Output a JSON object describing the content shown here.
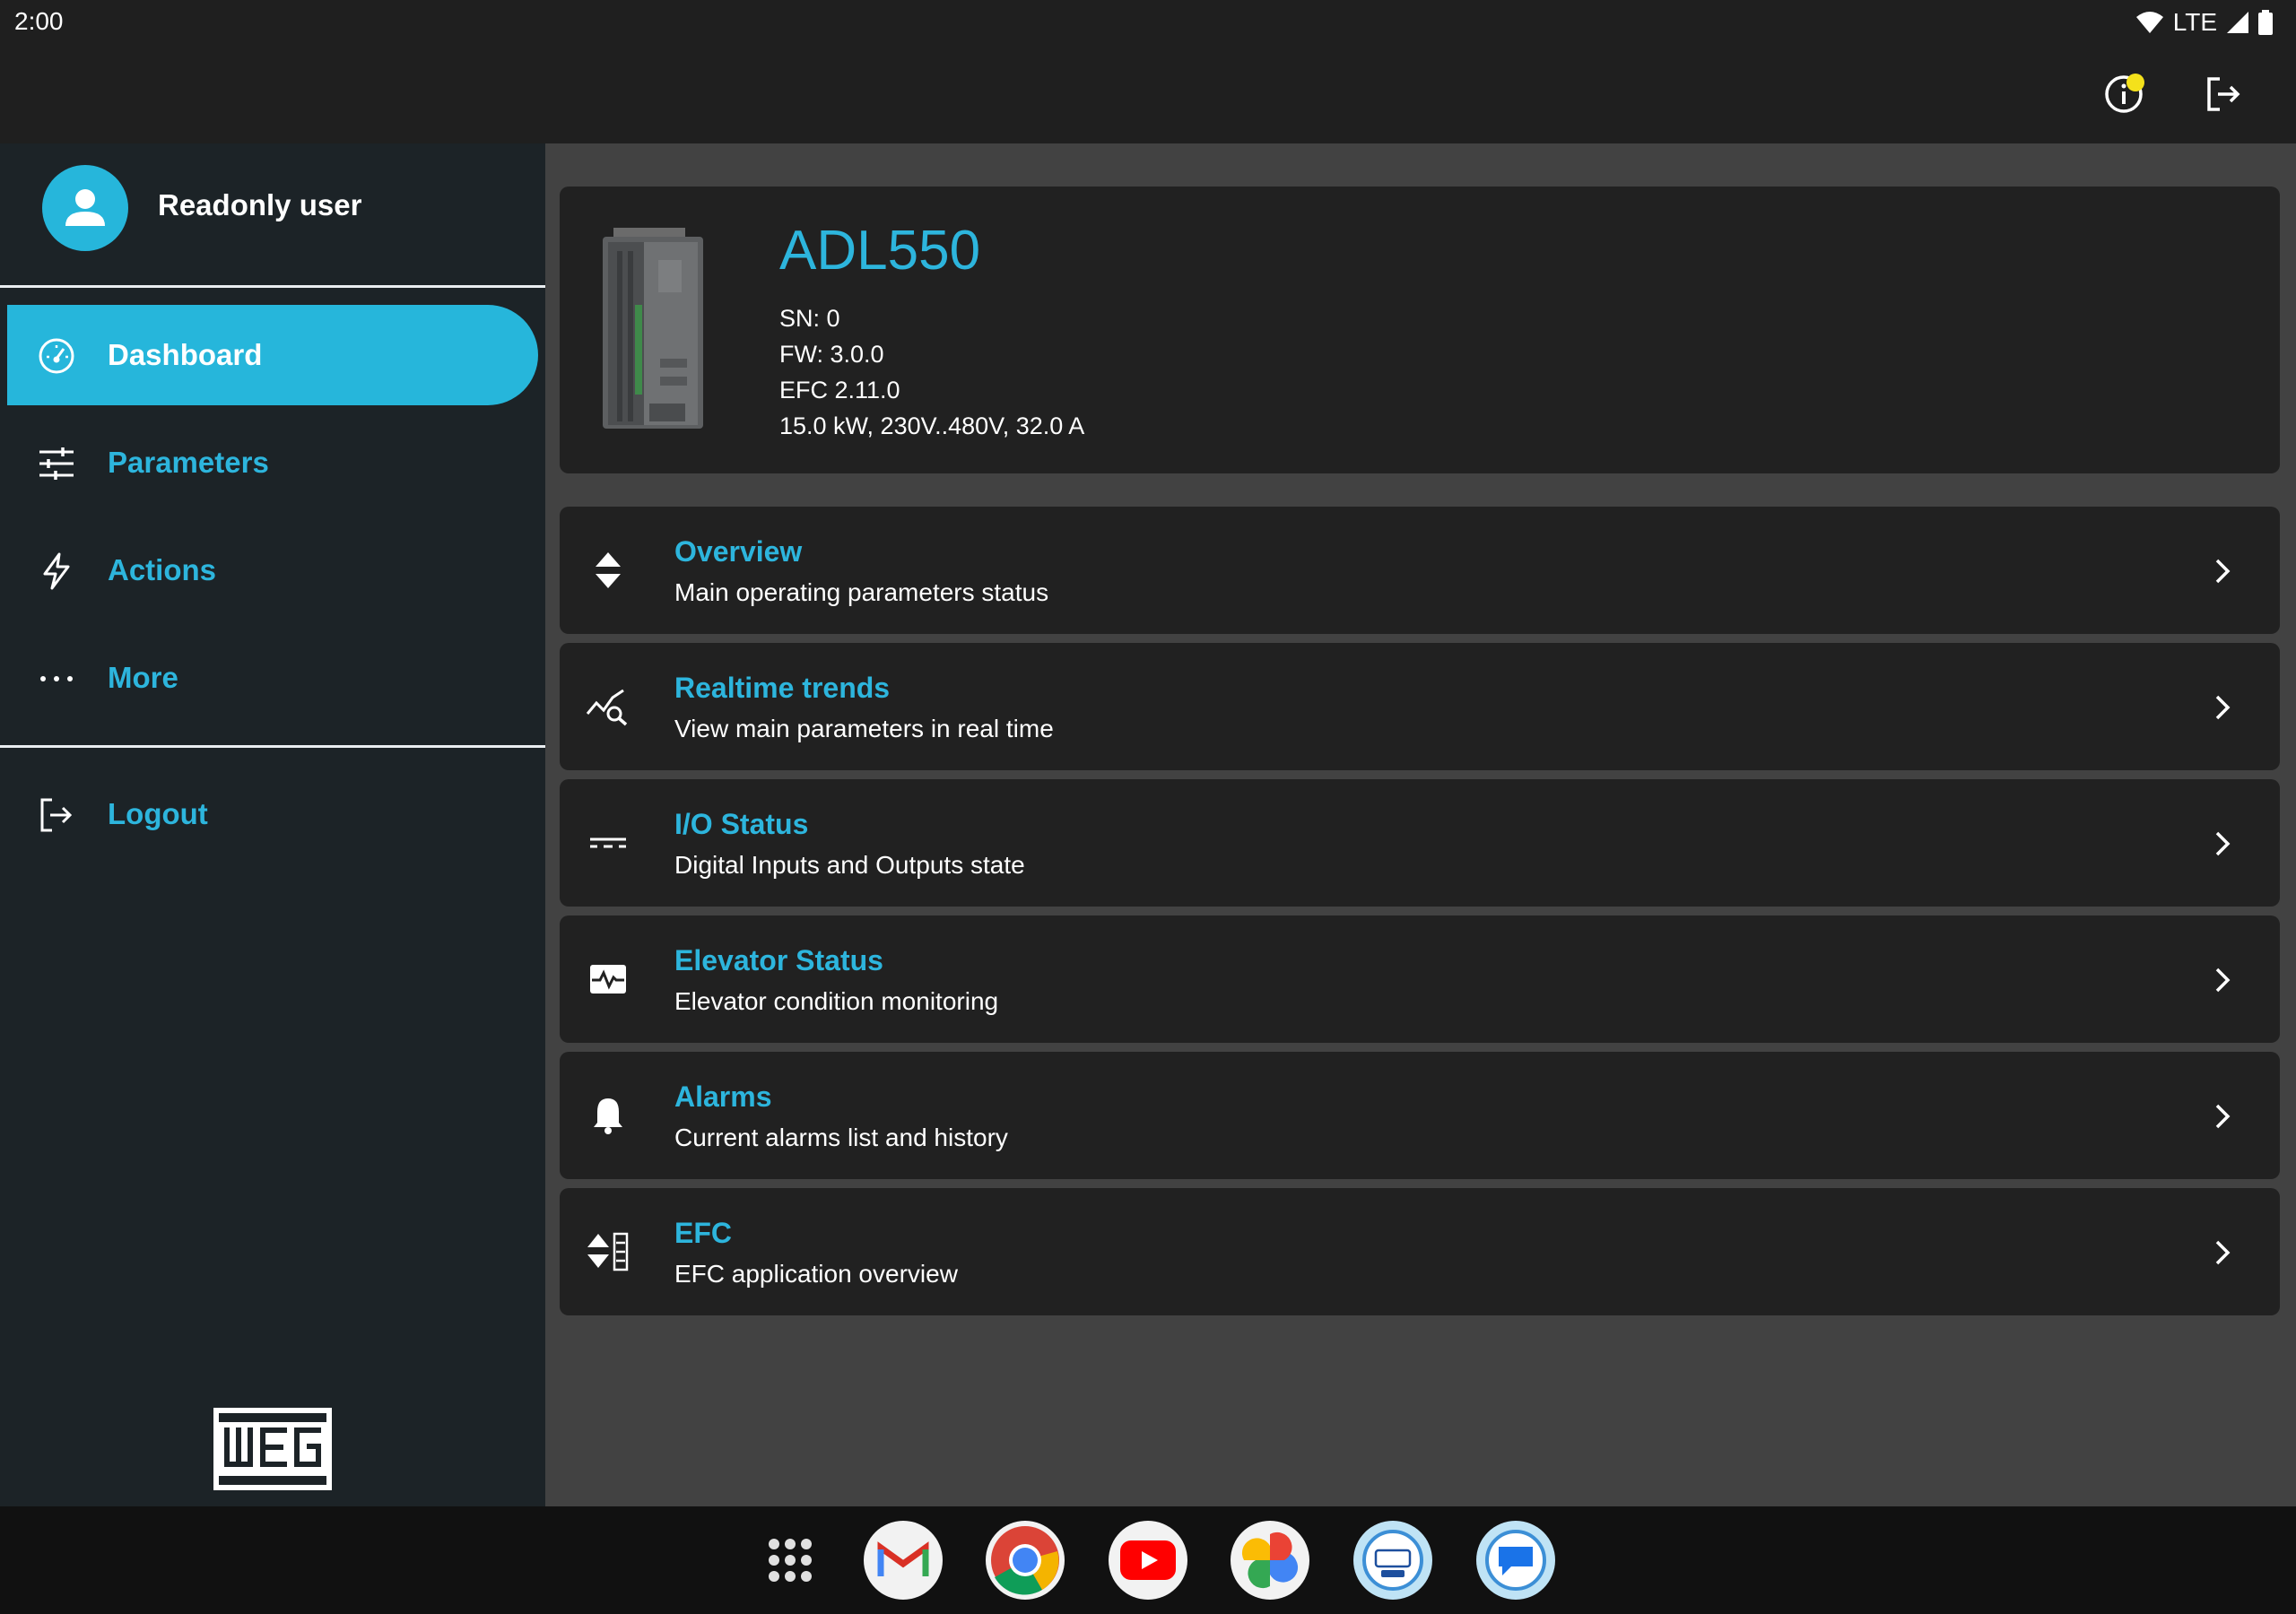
{
  "status_bar": {
    "time": "2:00",
    "network": "LTE",
    "icons": [
      "wifi-icon",
      "cell-signal-icon",
      "battery-icon"
    ]
  },
  "top_bar": {
    "actions": [
      "info-icon",
      "logout-icon"
    ],
    "notification_color": "#f4e11b"
  },
  "sidebar": {
    "user": {
      "name": "Readonly user",
      "avatar_icon": "person-icon"
    },
    "items": [
      {
        "label": "Dashboard",
        "icon": "dashboard-gauge-icon",
        "active": true
      },
      {
        "label": "Parameters",
        "icon": "tune-sliders-icon",
        "active": false
      },
      {
        "label": "Actions",
        "icon": "bolt-icon",
        "active": false
      },
      {
        "label": "More",
        "icon": "more-horizontal-icon",
        "active": false
      }
    ],
    "logout": {
      "label": "Logout",
      "icon": "logout-icon"
    },
    "brand_logo": "WEG"
  },
  "device": {
    "model": "ADL550",
    "sn": "SN: 0",
    "fw": "FW: 3.0.0",
    "efc": "EFC 2.11.0",
    "rating": "15.0 kW, 230V..480V, 32.0 A"
  },
  "menu": [
    {
      "title": "Overview",
      "subtitle": "Main operating parameters status",
      "icon": "up-down-arrows-icon"
    },
    {
      "title": "Realtime trends",
      "subtitle": "View main parameters in real time",
      "icon": "trend-search-icon"
    },
    {
      "title": "I/O Status",
      "subtitle": "Digital Inputs and Outputs state",
      "icon": "io-lines-icon"
    },
    {
      "title": "Elevator Status",
      "subtitle": "Elevator condition monitoring",
      "icon": "monitor-heart-icon"
    },
    {
      "title": "Alarms",
      "subtitle": "Current alarms list and history",
      "icon": "bell-icon"
    },
    {
      "title": "EFC",
      "subtitle": "EFC application overview",
      "icon": "efc-icon"
    }
  ],
  "dock": [
    "app-drawer-icon",
    "gmail-icon",
    "chrome-icon",
    "youtube-icon",
    "photos-icon",
    "lift-app-icon",
    "messages-icon"
  ],
  "colors": {
    "accent": "#2db5dd",
    "active_nav": "#26b6db",
    "sidebar_bg": "#1c2327",
    "content_bg": "#424242",
    "card_bg": "#212121"
  }
}
